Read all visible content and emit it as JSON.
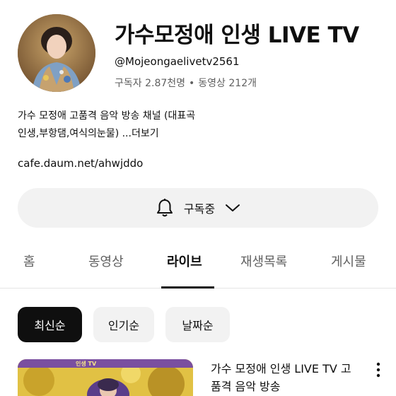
{
  "channel": {
    "title": "가수모정애 인생 LIVE TV",
    "handle": "@Mojeongaelivetv2561",
    "subscribers": "구독자 2.87천명",
    "separator": "•",
    "videos": "동영상 212개",
    "description_line1": "가수 모정애 고품격 음악 방송 채널 (대표곡",
    "description_line2": "인생,부항댐,여식의눈물) ...",
    "description_more": "더보기",
    "link": "cafe.daum.net/ahwjddo"
  },
  "subscribe": {
    "label": "구독중",
    "bell_icon": "bell-icon",
    "chevron_icon": "chevron-down-icon"
  },
  "tabs": [
    {
      "label": "홈",
      "active": false
    },
    {
      "label": "동영상",
      "active": false
    },
    {
      "label": "라이브",
      "active": true
    },
    {
      "label": "재생목록",
      "active": false
    },
    {
      "label": "게시물",
      "active": false
    }
  ],
  "filters": [
    {
      "label": "최신순",
      "active": true
    },
    {
      "label": "인기순",
      "active": false
    },
    {
      "label": "날짜순",
      "active": false
    }
  ],
  "video": {
    "title": "가수 모정애 인생 LIVE TV 고품격 음악 방송",
    "thumb_text": "인생 TV",
    "menu_icon": "more-vert-icon"
  },
  "colors": {
    "text": "#0f0f0f",
    "secondary": "#606060",
    "chip_bg": "#f2f2f2",
    "active_chip_bg": "#0f0f0f"
  }
}
